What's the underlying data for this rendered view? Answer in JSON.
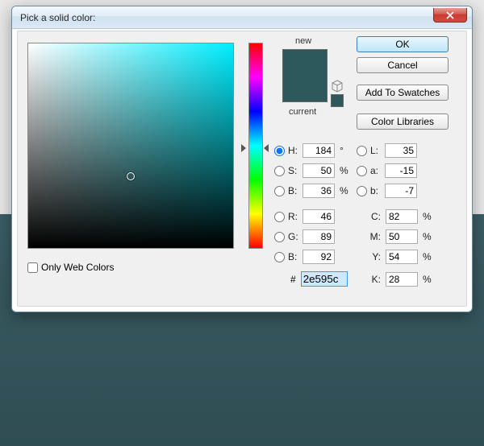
{
  "title": "Pick a solid color:",
  "buttons": {
    "ok": "OK",
    "cancel": "Cancel",
    "swatches": "Add To Swatches",
    "libraries": "Color Libraries"
  },
  "labels": {
    "new": "new",
    "current": "current",
    "web": "Only Web Colors",
    "H": "H:",
    "S": "S:",
    "Bv": "B:",
    "R": "R:",
    "G": "G:",
    "Bc": "B:",
    "L": "L:",
    "a": "a:",
    "b": "b:",
    "C": "C:",
    "M": "M:",
    "Y": "Y:",
    "K": "K:",
    "hash": "#",
    "deg": "°",
    "pct": "%"
  },
  "values": {
    "H": "184",
    "S": "50",
    "Bv": "36",
    "R": "46",
    "G": "89",
    "Bc": "92",
    "L": "35",
    "a": "-15",
    "b": "-7",
    "C": "82",
    "M": "50",
    "Y": "54",
    "K": "28",
    "hex": "2e595c"
  },
  "colors": {
    "new": "#2e595c",
    "current": "#2e595c"
  },
  "web_only": false,
  "radio_selected": "H"
}
